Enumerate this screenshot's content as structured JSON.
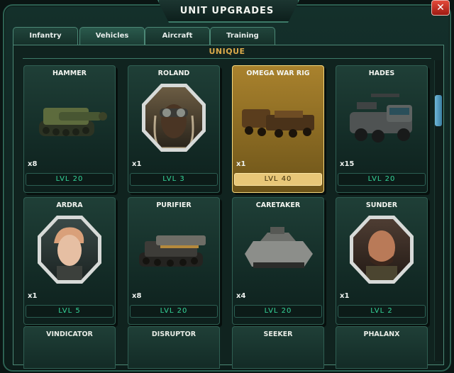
{
  "window": {
    "title": "UNIT UPGRADES",
    "close_label": "✕"
  },
  "tabs": [
    {
      "label": "Infantry",
      "active": false
    },
    {
      "label": "Vehicles",
      "active": true
    },
    {
      "label": "Aircraft",
      "active": false
    },
    {
      "label": "Training",
      "active": false
    }
  ],
  "section": {
    "label": "UNIQUE"
  },
  "units": [
    {
      "name": "HAMMER",
      "qty": "x8",
      "level": "LVL 20",
      "kind": "vehicle"
    },
    {
      "name": "ROLAND",
      "qty": "x1",
      "level": "LVL 3",
      "kind": "hero"
    },
    {
      "name": "OMEGA WAR RIG",
      "qty": "x1",
      "level": "LVL 40",
      "kind": "vehicle",
      "selected": true
    },
    {
      "name": "HADES",
      "qty": "x15",
      "level": "LVL 20",
      "kind": "vehicle"
    },
    {
      "name": "ARDRA",
      "qty": "x1",
      "level": "LVL 5",
      "kind": "hero"
    },
    {
      "name": "PURIFIER",
      "qty": "x8",
      "level": "LVL 20",
      "kind": "vehicle"
    },
    {
      "name": "CARETAKER",
      "qty": "x4",
      "level": "LVL 20",
      "kind": "vehicle"
    },
    {
      "name": "SUNDER",
      "qty": "x1",
      "level": "LVL 2",
      "kind": "hero"
    }
  ],
  "more_units": [
    "VINDICATOR",
    "DISRUPTOR",
    "SEEKER",
    "PHALANX"
  ],
  "colors": {
    "accent": "#35d69a",
    "gold": "#d9a94a",
    "selected": "#e8c778"
  }
}
